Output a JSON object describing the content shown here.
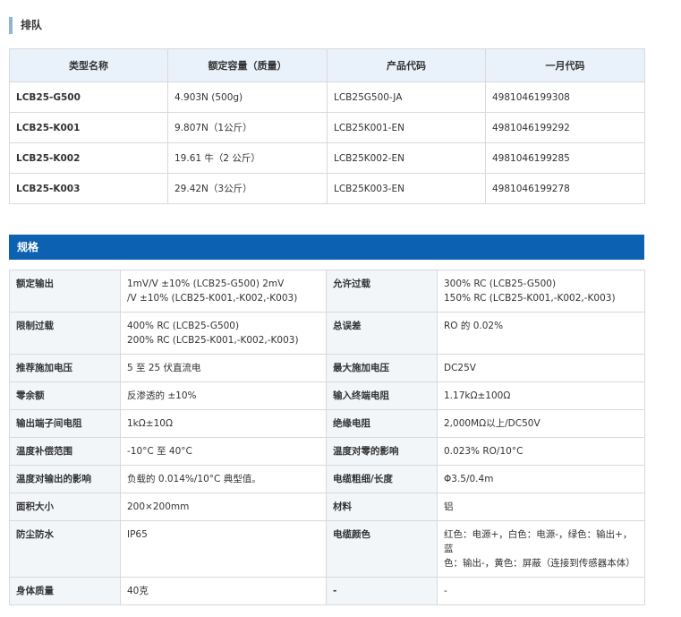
{
  "lineup": {
    "heading": "排队",
    "headers": [
      "类型名称",
      "额定容量（质量）",
      "产品代码",
      "一月代码"
    ],
    "rows": [
      [
        "LCB25-G500",
        "4.903N (500g)",
        "LCB25G500-JA",
        "4981046199308"
      ],
      [
        "LCB25-K001",
        "9.807N（1公斤）",
        "LCB25K001-EN",
        "4981046199292"
      ],
      [
        "LCB25-K002",
        "19.61 牛（2 公斤）",
        "LCB25K002-EN",
        "4981046199285"
      ],
      [
        "LCB25-K003",
        "29.42N（3公斤）",
        "LCB25K003-EN",
        "4981046199278"
      ]
    ]
  },
  "specs": {
    "heading": "规格",
    "rows": [
      {
        "l1": "额定输出",
        "v1a": "1mV/V ±10% (LCB25-G500) 2mV",
        "v1b": "/V ±10% (LCB25-K001,-K002,-K003)",
        "l2": "允许过载",
        "v2a": "300% RC (LCB25-G500)",
        "v2b": "150% RC (LCB25-K001,-K002,-K003)"
      },
      {
        "l1": "限制过载",
        "v1a": "400% RC (LCB25-G500)",
        "v1b": "200% RC (LCB25-K001,-K002,-K003)",
        "l2": "总误差",
        "v2a": "RO 的 0.02%",
        "v2b": ""
      },
      {
        "l1": "推荐施加电压",
        "v1a": "5 至 25 伏直流电",
        "v1b": "",
        "l2": "最大施加电压",
        "v2a": "DC25V",
        "v2b": ""
      },
      {
        "l1": "零余额",
        "v1a": "反渗透的 ±10%",
        "v1b": "",
        "l2": "输入终端电阻",
        "v2a": "1.17kΩ±100Ω",
        "v2b": ""
      },
      {
        "l1": "输出端子间电阻",
        "v1a": "1kΩ±10Ω",
        "v1b": "",
        "l2": "绝缘电阻",
        "v2a": "2,000MΩ以上/DC50V",
        "v2b": ""
      },
      {
        "l1": "温度补偿范围",
        "v1a": "-10°C 至 40°C",
        "v1b": "",
        "l2": "温度对零的影响",
        "v2a": "0.023% RO/10°C",
        "v2b": ""
      },
      {
        "l1": "温度对输出的影响",
        "v1a": "负载的 0.014%/10°C 典型值。",
        "v1b": "",
        "l2": "电缆粗细/长度",
        "v2a": "Φ3.5/0.4m",
        "v2b": ""
      },
      {
        "l1": "面积大小",
        "v1a": "200×200mm",
        "v1b": "",
        "l2": "材料",
        "v2a": "铝",
        "v2b": ""
      },
      {
        "l1": "防尘防水",
        "v1a": "IP65",
        "v1b": "",
        "l2": "电缆颜色",
        "v2a": "红色：电源+，白色：电源-，绿色：输出+，蓝",
        "v2b": "色：输出-，黄色：屏蔽（连接到传感器本体）"
      },
      {
        "l1": "身体质量",
        "v1a": "40克",
        "v1b": "",
        "l2": "-",
        "v2a": "-",
        "v2b": ""
      }
    ]
  }
}
